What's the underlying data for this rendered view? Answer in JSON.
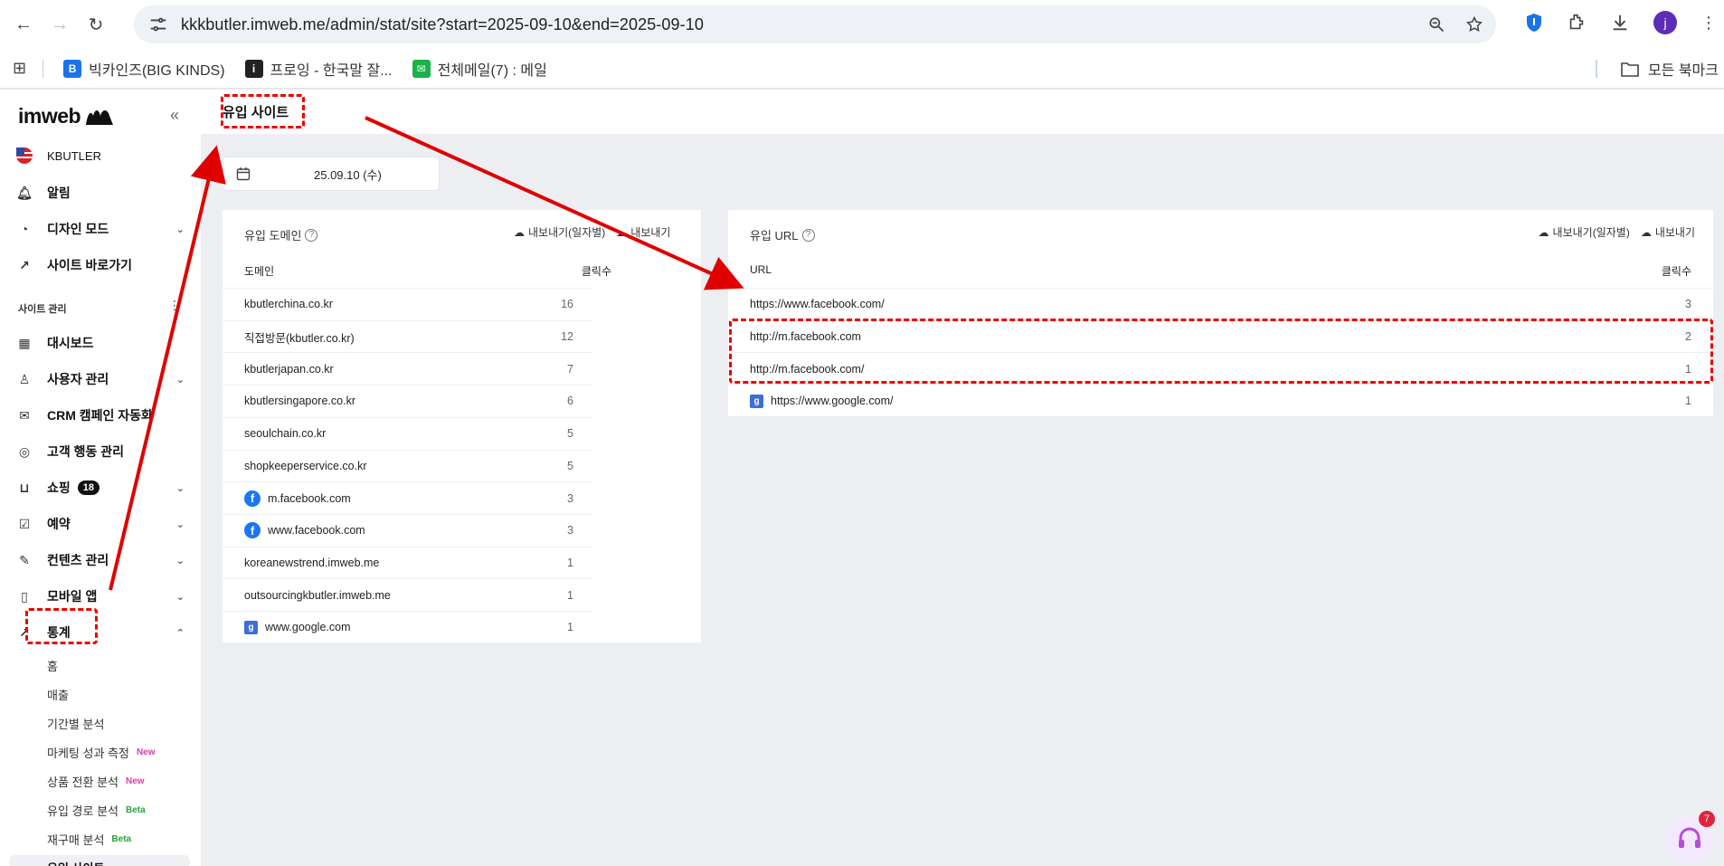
{
  "browser": {
    "url": "kkkbutler.imweb.me/admin/stat/site?start=2025-09-10&end=2025-09-10",
    "avatar_letter": "j",
    "bookmarks": [
      {
        "label": "빅카인즈(BIG KINDS)",
        "icon_letter": "B",
        "icon_color": "#1a73e8"
      },
      {
        "label": "프로잉 - 한국말 잘...",
        "icon_letter": "i",
        "icon_color": "#222222"
      },
      {
        "label": "전체메일(7) : 메일",
        "icon_letter": "✉",
        "icon_color": "#19b34a"
      }
    ],
    "all_bookmarks": "모든 북마크"
  },
  "sidebar": {
    "logo": "imweb",
    "site_name": "KBUTLER",
    "items_top": [
      {
        "label": "알림",
        "icon": "bell-icon"
      },
      {
        "label": "디자인 모드",
        "icon": "palette-icon",
        "chevron": "⌄"
      },
      {
        "label": "사이트 바로가기",
        "icon": "external-link-icon"
      }
    ],
    "section_label": "사이트 관리",
    "items": [
      {
        "label": "대시보드",
        "icon": "dashboard-icon"
      },
      {
        "label": "사용자 관리",
        "icon": "user-icon",
        "chevron": "⌄"
      },
      {
        "label": "CRM 캠페인 자동화",
        "icon": "mail-icon"
      },
      {
        "label": "고객 행동 관리",
        "icon": "target-icon"
      },
      {
        "label": "쇼핑",
        "icon": "shopping-bag-icon",
        "chevron": "⌄",
        "badge": "18"
      },
      {
        "label": "예약",
        "icon": "calendar-check-icon",
        "chevron": "⌄"
      },
      {
        "label": "컨텐츠 관리",
        "icon": "edit-icon",
        "chevron": "⌄"
      },
      {
        "label": "모바일 앱",
        "icon": "mobile-icon",
        "chevron": "⌄"
      },
      {
        "label": "통계",
        "icon": "chart-icon",
        "chevron": "⌃"
      }
    ],
    "stat_sub": [
      {
        "label": "홈",
        "tag": "",
        "tag_type": ""
      },
      {
        "label": "매출",
        "tag": "",
        "tag_type": ""
      },
      {
        "label": "기간별 분석",
        "tag": "",
        "tag_type": ""
      },
      {
        "label": "마케팅 성과 측정",
        "tag": "New",
        "tag_type": "new"
      },
      {
        "label": "상품 전환 분석",
        "tag": "New",
        "tag_type": "new"
      },
      {
        "label": "유입 경로 분석",
        "tag": "Beta",
        "tag_type": "beta"
      },
      {
        "label": "재구매 분석",
        "tag": "Beta",
        "tag_type": "beta"
      },
      {
        "label": "유입 사이트",
        "tag": "",
        "tag_type": ""
      }
    ]
  },
  "page": {
    "title": "유입 사이트",
    "date": "25.09.10 (수)"
  },
  "domain_panel": {
    "title": "유입 도메인",
    "export_daily": "내보내기(일자별)",
    "export": "내보내기",
    "col_name": "도메인",
    "col_count": "클릭수",
    "rows": [
      {
        "name": "kbutlerchina.co.kr",
        "count": "16",
        "icon": ""
      },
      {
        "name": "직접방문(kbutler.co.kr)",
        "count": "12",
        "icon": ""
      },
      {
        "name": "kbutlerjapan.co.kr",
        "count": "7",
        "icon": ""
      },
      {
        "name": "kbutlersingapore.co.kr",
        "count": "6",
        "icon": ""
      },
      {
        "name": "seoulchain.co.kr",
        "count": "5",
        "icon": ""
      },
      {
        "name": "shopkeeperservice.co.kr",
        "count": "5",
        "icon": ""
      },
      {
        "name": "m.facebook.com",
        "count": "3",
        "icon": "facebook"
      },
      {
        "name": "www.facebook.com",
        "count": "3",
        "icon": "facebook"
      },
      {
        "name": "koreanewstrend.imweb.me",
        "count": "1",
        "icon": ""
      },
      {
        "name": "outsourcingkbutler.imweb.me",
        "count": "1",
        "icon": ""
      },
      {
        "name": "www.google.com",
        "count": "1",
        "icon": "google"
      }
    ]
  },
  "url_panel": {
    "title": "유입 URL",
    "export_daily": "내보내기(일자별)",
    "export": "내보내기",
    "col_name": "URL",
    "col_count": "클릭수",
    "rows": [
      {
        "name": "https://www.facebook.com/",
        "count": "3",
        "icon": ""
      },
      {
        "name": "http://m.facebook.com",
        "count": "2",
        "icon": ""
      },
      {
        "name": "http://m.facebook.com/",
        "count": "1",
        "icon": ""
      },
      {
        "name": "https://www.google.com/",
        "count": "1",
        "icon": "google"
      }
    ]
  },
  "help_badge": "7",
  "colors": {
    "annotation": "#e00000",
    "accent": "#1877f2"
  }
}
